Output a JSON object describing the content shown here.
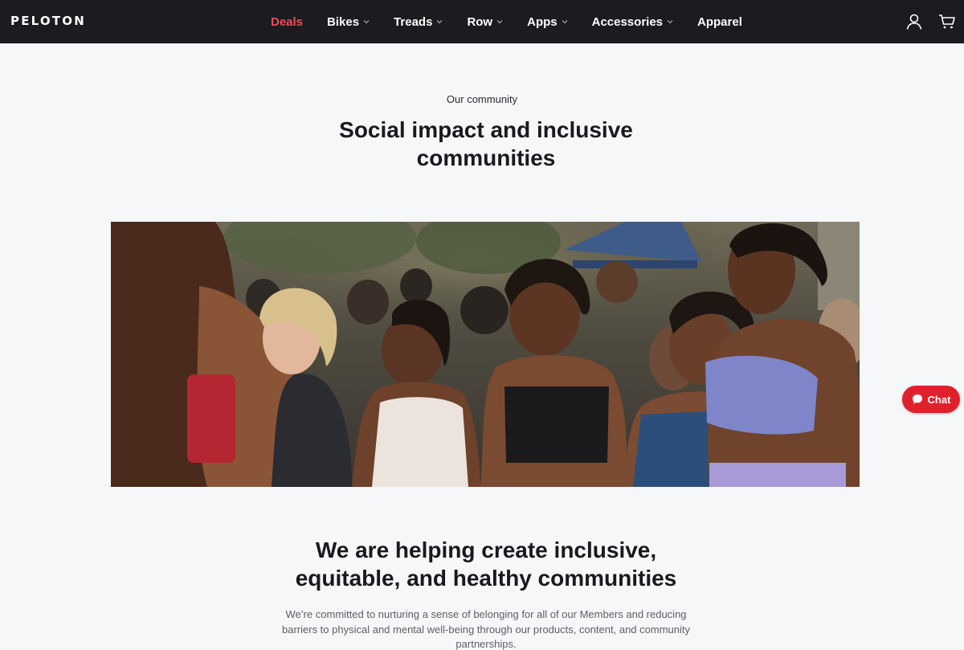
{
  "brand": {
    "logo_text": "PELOTON"
  },
  "nav": {
    "items": [
      {
        "label": "Deals",
        "has_dropdown": false,
        "highlight": true
      },
      {
        "label": "Bikes",
        "has_dropdown": true
      },
      {
        "label": "Treads",
        "has_dropdown": true
      },
      {
        "label": "Row",
        "has_dropdown": true
      },
      {
        "label": "Apps",
        "has_dropdown": true
      },
      {
        "label": "Accessories",
        "has_dropdown": true
      },
      {
        "label": "Apparel",
        "has_dropdown": false
      }
    ],
    "icons": [
      "account-icon",
      "cart-icon"
    ]
  },
  "hero": {
    "eyebrow": "Our community",
    "title": "Social impact and inclusive communities"
  },
  "section": {
    "title": "We are helping create inclusive, equitable, and healthy communities",
    "body": "We’re committed to nurturing a sense of belonging for all of our Members and reducing barriers to physical and mental well-being through our products, content, and community partnerships."
  },
  "chat": {
    "label": "Chat",
    "icon": "chat-bubble-icon"
  },
  "colors": {
    "nav_bg": "#1b1c20",
    "accent_deals": "#ef4b5a",
    "chat_bg": "#e0202c",
    "page_bg": "#f6f7f9"
  }
}
